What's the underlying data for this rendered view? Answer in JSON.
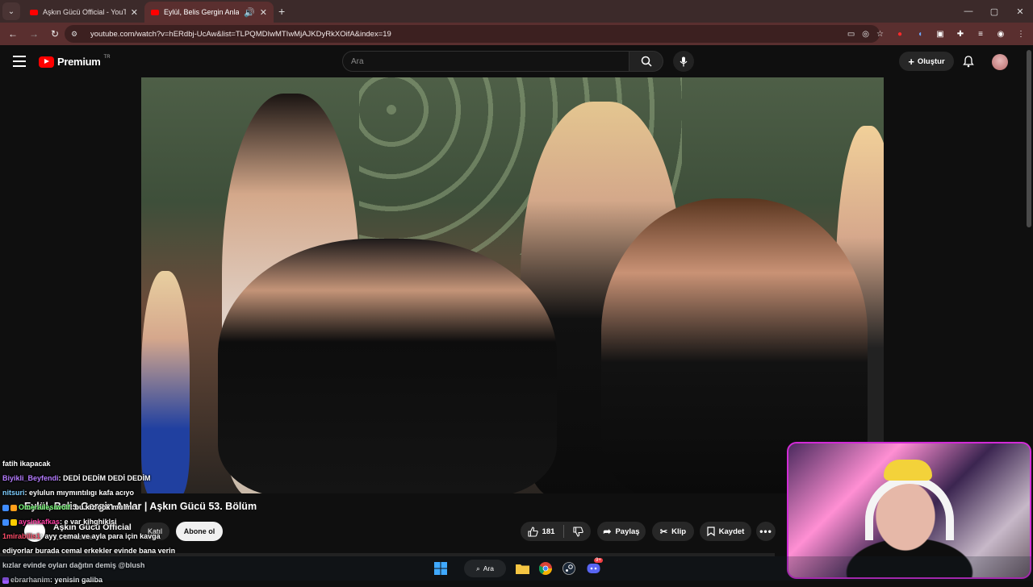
{
  "browser": {
    "tabs": [
      {
        "title": "Aşkın Gücü Official - YouTube",
        "active": false
      },
      {
        "title": "Eylül, Belis Gergin Anlar | Aşkın",
        "active": true
      }
    ],
    "url": "youtube.com/watch?v=hERdbj-UcAw&list=TLPQMDIwMTIwMjAJKDyRkXOifA&index=19"
  },
  "youtube": {
    "logo_text": "Premium",
    "logo_region": "TR",
    "search_placeholder": "Ara",
    "create_label": "Oluştur"
  },
  "video": {
    "title": "Eylül, Belis Gergin Anlar | Aşkın Gücü 53. Bölüm",
    "channel": "Aşkın Gücü Official",
    "subscribers": "1,1 Mn abone",
    "join_label": "Katıl",
    "subscribe_label": "Abone ol",
    "likes": "181",
    "share_label": "Paylaş",
    "clip_label": "Klip",
    "save_label": "Kaydet"
  },
  "chat": [
    {
      "user": "fatih ikapacak",
      "message": "",
      "color": "#ffffff"
    },
    {
      "user": "Biyikli_Beyfendi",
      "message": ": DEDİ DEDİM DEDİ DEDİM",
      "color": "#b57cff"
    },
    {
      "user": "nitsuri",
      "message": ": eylulun mıymıntılıgı kafa acıyo",
      "color": "#7ecfff"
    },
    {
      "user": "Omerailesiwolf",
      "message": ": bu kız ook mu mı",
      "color": "#7cff7c"
    },
    {
      "user": "aysinkafkas",
      "message": ": e var kihghiklsi",
      "color": "#ff3ea5"
    },
    {
      "user": "1mirabilis1",
      "message": ": ayy cemal ve ayla para için kavga",
      "color": "#ff4d6a"
    },
    {
      "user": "",
      "message": "ediyorlar burada cemal erkekler evinde bana verin",
      "color": "#ffffff"
    },
    {
      "user": "",
      "message": "kızlar evinde oyları dağıtın demiş @blush",
      "color": "#ffffff"
    },
    {
      "user": "ebrarhanim",
      "message": ": yenisin galiba",
      "color": "#ffffff"
    }
  ],
  "taskbar": {
    "search_label": "Ara",
    "discord_badge": "9+"
  }
}
